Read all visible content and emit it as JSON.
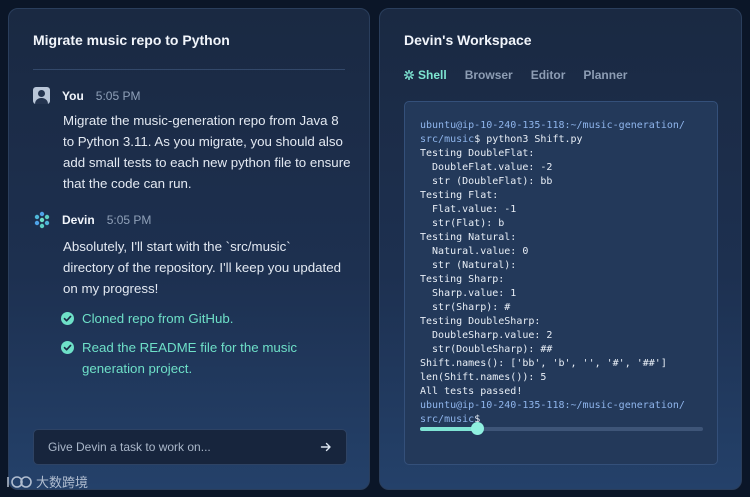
{
  "chat": {
    "title": "Migrate music repo to Python",
    "messages": [
      {
        "author": "You",
        "time": "5:05 PM",
        "lines": [
          "Migrate the music-generation repo from Java 8",
          "to Python 3.11. As you migrate, you should also",
          "add small tests to each new python file to ensure",
          "that the code can run."
        ],
        "avatar": "user-avatar-icon"
      },
      {
        "author": "Devin",
        "time": "5:05 PM",
        "lines": [
          "Absolutely, I'll start with the `src/music`",
          "directory of the repository. I'll keep you updated",
          "on my progress!"
        ],
        "avatar": "devin-logo-icon",
        "checklist": [
          {
            "lines": [
              "Cloned repo from GitHub."
            ]
          },
          {
            "lines": [
              "Read the README file for the music",
              "generation project."
            ]
          }
        ]
      }
    ],
    "input_placeholder": "Give Devin a task to work on...",
    "send_icon": "arrow-right-icon"
  },
  "workspace": {
    "title": "Devin's Workspace",
    "tabs": [
      {
        "label": "Shell",
        "icon": "gear-icon",
        "active": true
      },
      {
        "label": "Browser",
        "active": false
      },
      {
        "label": "Editor",
        "active": false
      },
      {
        "label": "Planner",
        "active": false
      }
    ],
    "terminal_lines": [
      {
        "prompt": "ubuntu@ip-10-240-135-118:~/music-generation/",
        "text": ""
      },
      {
        "prompt": "src/music",
        "text": "$ python3 Shift.py"
      },
      {
        "text": "Testing DoubleFlat:"
      },
      {
        "text": "  DoubleFlat.value: -2"
      },
      {
        "text": "  str (DoubleFlat): bb"
      },
      {
        "text": "Testing Flat:"
      },
      {
        "text": "  Flat.value: -1"
      },
      {
        "text": "  str(Flat): b"
      },
      {
        "text": "Testing Natural:"
      },
      {
        "text": "  Natural.value: 0"
      },
      {
        "text": "  str (Natural):"
      },
      {
        "text": "Testing Sharp:"
      },
      {
        "text": "  Sharp.value: 1"
      },
      {
        "text": "  str(Sharp): #"
      },
      {
        "text": "Testing DoubleSharp:"
      },
      {
        "text": "  DoubleSharp.value: 2"
      },
      {
        "text": "  str(DoubleSharp): ##"
      },
      {
        "text": "Shift.names(): ['bb', 'b', '', '#', '##']"
      },
      {
        "text": "len(Shift.names()): 5"
      },
      {
        "text": "All tests passed!"
      },
      {
        "prompt": "ubuntu@ip-10-240-135-118:~/music-generation/",
        "text": ""
      },
      {
        "prompt": "src/music",
        "text": "$"
      }
    ],
    "playback_progress": 0.2
  },
  "watermark": {
    "text": "大数跨境"
  },
  "colors": {
    "accent": "#7ee6d2",
    "check": "#6ee0c8",
    "prompt": "#8fb5ec",
    "background": "#0b1628"
  }
}
